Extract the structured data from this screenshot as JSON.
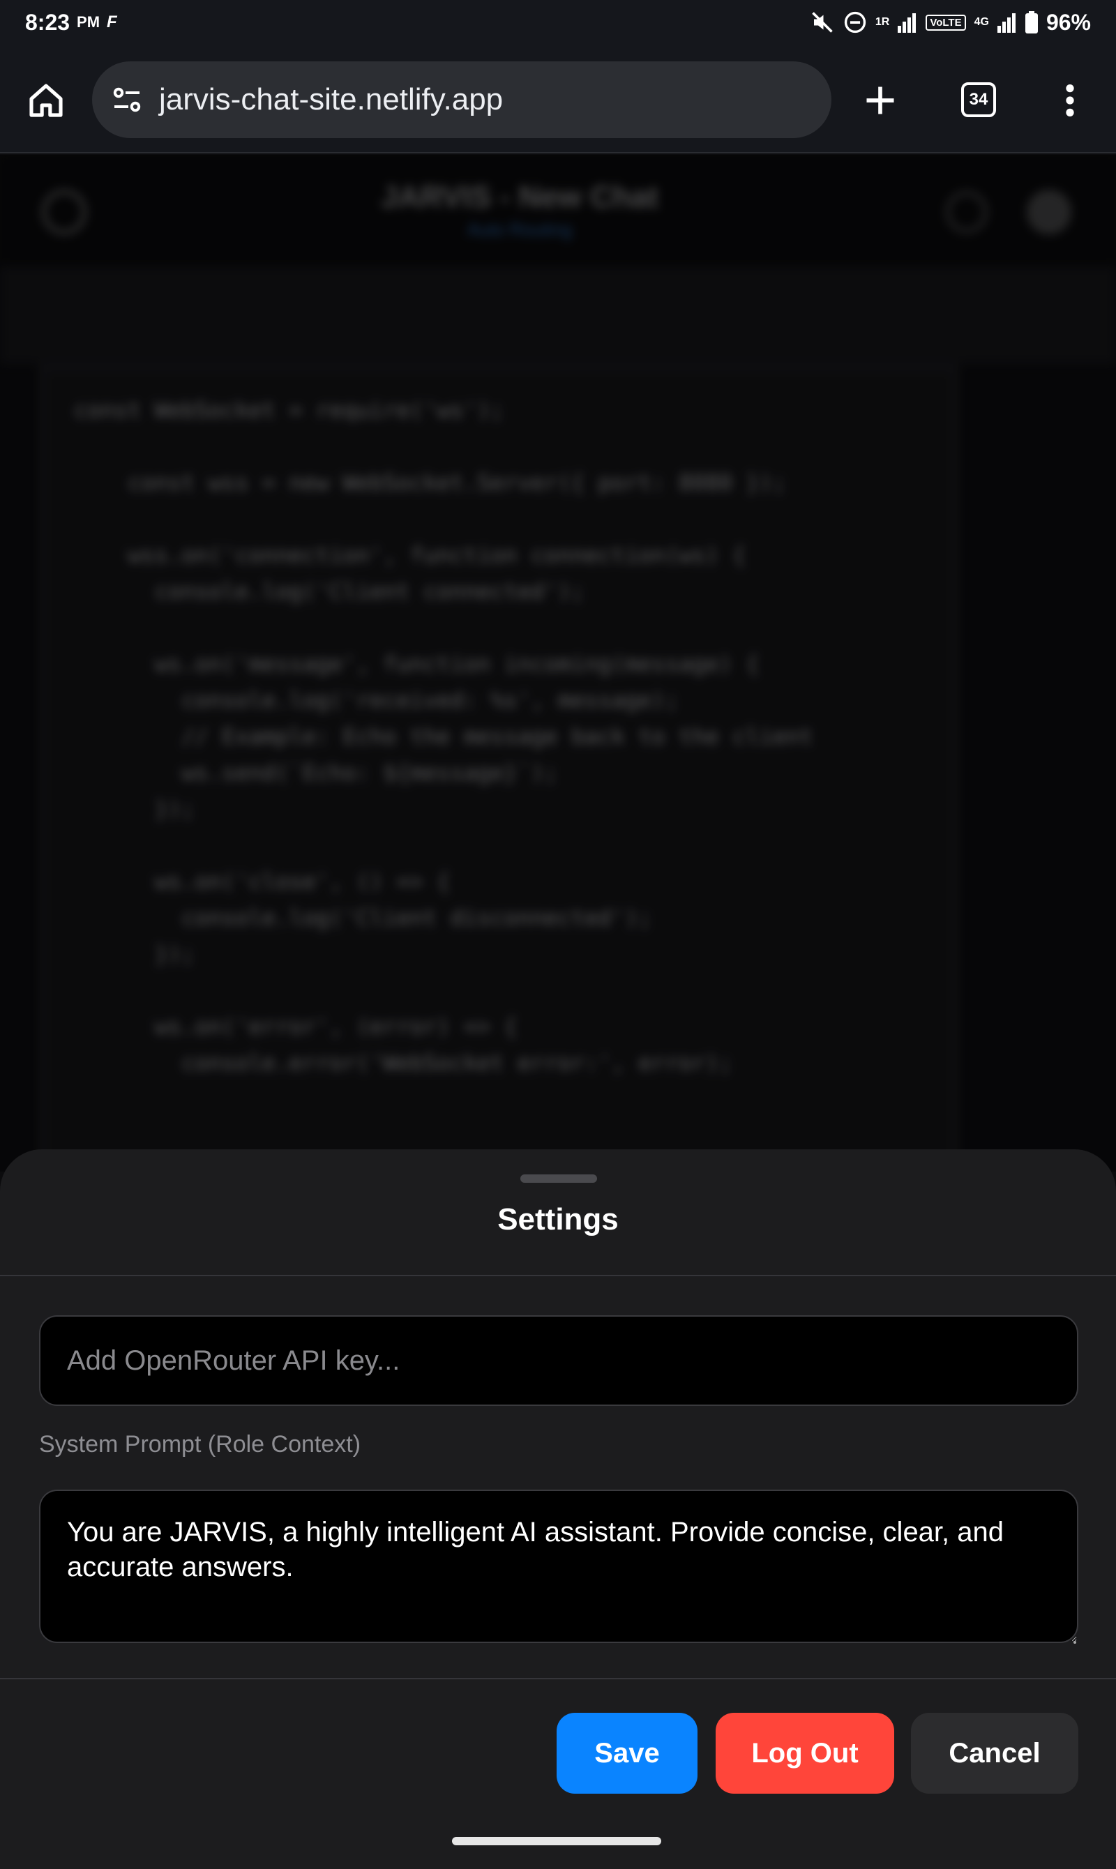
{
  "status_bar": {
    "time": "8:23",
    "ampm": "PM",
    "carrier_glyph": "F",
    "sim1_label": "1R",
    "volte_label": "VoLTE",
    "net_label": "4G",
    "battery": "96%"
  },
  "browser": {
    "url": "jarvis-chat-site.netlify.app",
    "tab_count": "34"
  },
  "background_app": {
    "title": "JARVIS - New Chat",
    "subtitle": "Auto Routing",
    "code_lines": [
      "const WebSocket = require('ws');",
      "",
      "    const wss = new WebSocket.Server({ port: 8080 });",
      "",
      "    wss.on('connection', function connection(ws) {",
      "      console.log('Client connected');",
      "",
      "      ws.on('message', function incoming(message) {",
      "        console.log('received: %s', message);",
      "        // Example: Echo the message back to the client",
      "        ws.send(`Echo: ${message}`);",
      "      });",
      "",
      "      ws.on('close', () => {",
      "        console.log('Client disconnected');",
      "      });",
      "",
      "      ws.on('error', (error) => {",
      "        console.error('WebSocket error:', error);"
    ]
  },
  "settings": {
    "title": "Settings",
    "api_key_value": "",
    "api_key_placeholder": "Add OpenRouter API key...",
    "system_prompt_label": "System Prompt (Role Context)",
    "system_prompt_value": "You are JARVIS, a highly intelligent AI assistant. Provide concise, clear, and accurate answers.",
    "save_label": "Save",
    "logout_label": "Log Out",
    "cancel_label": "Cancel"
  },
  "colors": {
    "save": "#0a84ff",
    "logout": "#ff453a",
    "cancel": "#2c2c2e",
    "sheet_bg": "#1c1c1e"
  }
}
